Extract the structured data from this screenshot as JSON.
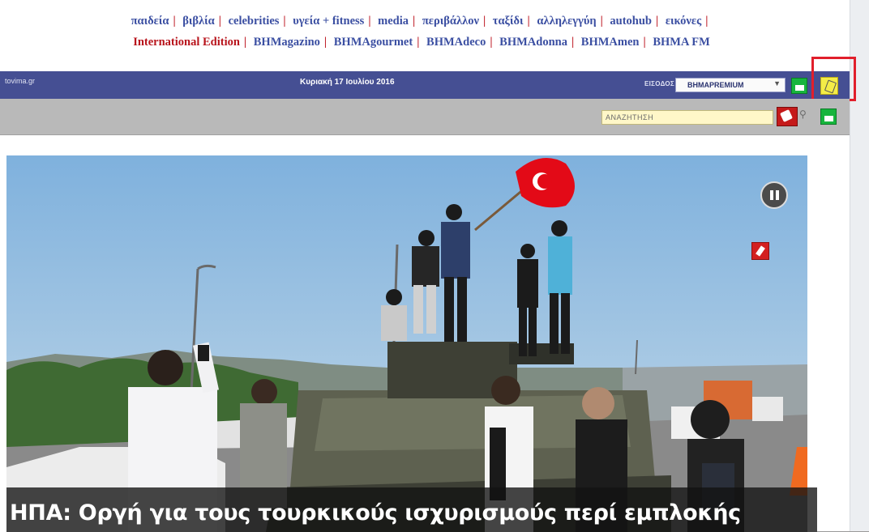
{
  "nav": {
    "row1": [
      "παιδεία",
      "βιβλία",
      "celebrities",
      "υγεία + fitness",
      "media",
      "περιβάλλον",
      "ταξίδι",
      "αλληλεγγύη",
      "autohub",
      "εικόνες"
    ],
    "row2": [
      "International Edition",
      "BHMagazino",
      "BHMAgourmet",
      "BHMAdeco",
      "BHMAdonna",
      "BHMAmen",
      "BHMA FM"
    ],
    "separator": "|"
  },
  "topbar": {
    "site_url": "tovima.gr",
    "date": "Κυριακή 17 Ιουλίου 2016",
    "login_label": "ΕΙΣΟΔΟΣ",
    "premium_selected": "BHMAPREMIUM",
    "caret": "▼"
  },
  "search": {
    "placeholder": "ΑΝΑΖΗΤΗΣΗ",
    "glass_glyph": "⚲"
  },
  "hero": {
    "headline": "ΗΠΑ: Οργή για τους τουρκικούς ισχυρισμούς περί εμπλοκής"
  },
  "colors": {
    "nav_blue": "#3b4fa2",
    "nav_red": "#b8141c",
    "topbar": "#454f93",
    "subbar": "#b9b9b9",
    "search_field": "#fff7c8",
    "highlight": "#e11f2b",
    "flag_red": "#e30a17"
  },
  "icons": {
    "green_buttons": "green-login-icon",
    "yellow_tool": "tools-icon",
    "hand": "hand-icon",
    "pause": "pause-icon",
    "share": "share-icon",
    "search": "search-icon"
  }
}
